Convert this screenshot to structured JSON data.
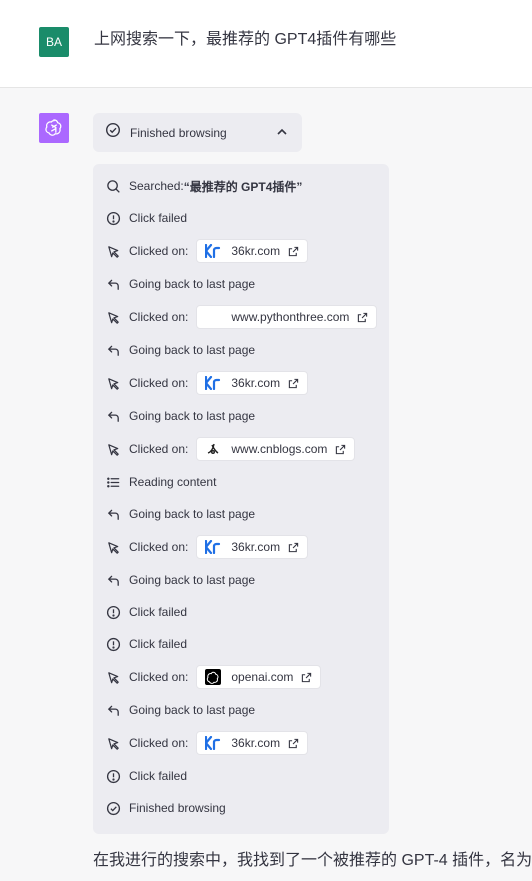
{
  "user": {
    "avatar": "BA",
    "message": "上网搜索一下，最推荐的 GPT4插件有哪些"
  },
  "assistant": {
    "toggle_label": "Finished browsing",
    "log": [
      {
        "icon": "search-icon",
        "text": "Searched: ",
        "bold": "“最推荐的 GPT4插件”"
      },
      {
        "icon": "alert-circle-icon",
        "text": "Click failed"
      },
      {
        "icon": "cursor-icon",
        "text": "Clicked on:",
        "chip": {
          "site": "36kr.com",
          "favicon": "36kr-logo"
        }
      },
      {
        "icon": "back-arrow-icon",
        "text": "Going back to last page"
      },
      {
        "icon": "cursor-icon",
        "text": "Clicked on:",
        "chip": {
          "site": "www.pythonthree.com",
          "favicon": "blank"
        }
      },
      {
        "icon": "back-arrow-icon",
        "text": "Going back to last page"
      },
      {
        "icon": "cursor-icon",
        "text": "Clicked on:",
        "chip": {
          "site": "36kr.com",
          "favicon": "36kr-logo"
        }
      },
      {
        "icon": "back-arrow-icon",
        "text": "Going back to last page"
      },
      {
        "icon": "cursor-icon",
        "text": "Clicked on:",
        "chip": {
          "site": "www.cnblogs.com",
          "favicon": "cnblogs-logo"
        }
      },
      {
        "icon": "list-icon",
        "text": "Reading content"
      },
      {
        "icon": "back-arrow-icon",
        "text": "Going back to last page"
      },
      {
        "icon": "cursor-icon",
        "text": "Clicked on:",
        "chip": {
          "site": "36kr.com",
          "favicon": "36kr-logo"
        }
      },
      {
        "icon": "back-arrow-icon",
        "text": "Going back to last page"
      },
      {
        "icon": "alert-circle-icon",
        "text": "Click failed"
      },
      {
        "icon": "alert-circle-icon",
        "text": "Click failed"
      },
      {
        "icon": "cursor-icon",
        "text": "Clicked on:",
        "chip": {
          "site": "openai.com",
          "favicon": "openai-logo"
        }
      },
      {
        "icon": "back-arrow-icon",
        "text": "Going back to last page"
      },
      {
        "icon": "cursor-icon",
        "text": "Clicked on:",
        "chip": {
          "site": "36kr.com",
          "favicon": "36kr-logo"
        }
      },
      {
        "icon": "alert-circle-icon",
        "text": "Click failed"
      },
      {
        "icon": "check-circle-icon",
        "text": "Finished browsing"
      }
    ],
    "answer": "在我进行的搜索中，我找到了一个被推荐的 GPT-4 插件，名为"
  },
  "colors": {
    "user_avatar": "#1a8c6a",
    "assistant_avatar": "#ab68ff",
    "panel": "#ececf1",
    "link_blue": "#1f6fe5"
  }
}
